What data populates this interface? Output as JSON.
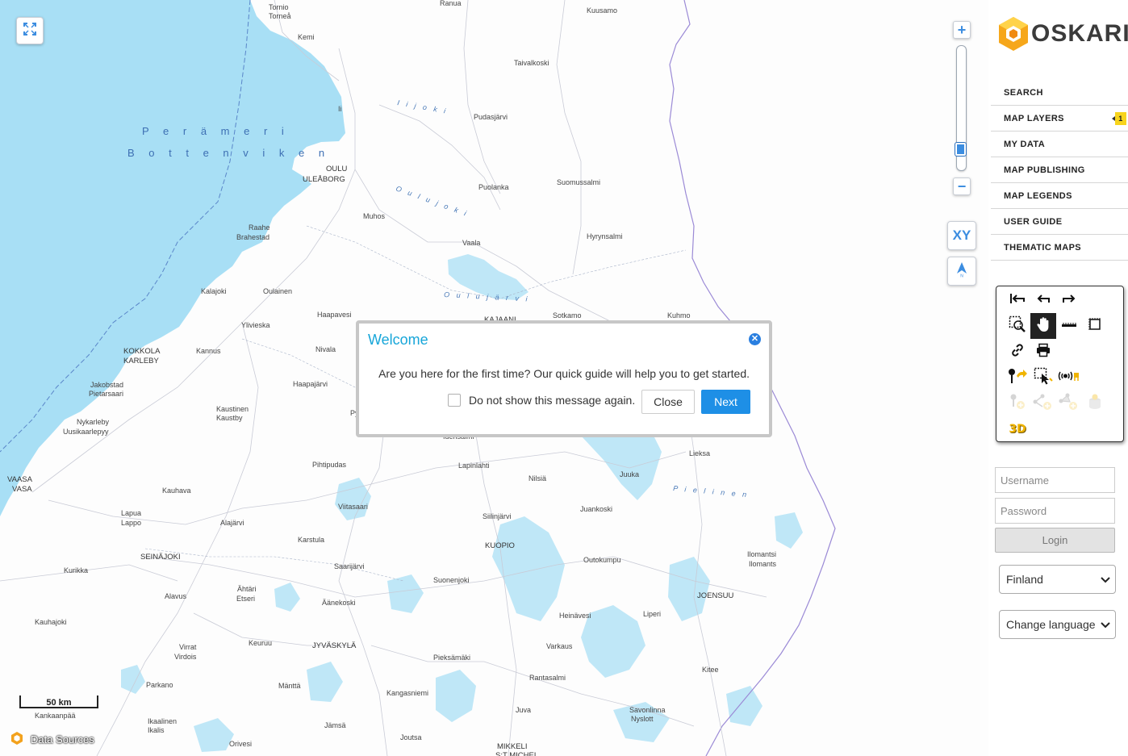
{
  "map": {
    "sea_labels": [
      "P e r ä m e r i",
      "B o t t e n v i k e n"
    ],
    "water_labels": [
      "I i j o k i",
      "O u l u j o k i",
      "O u l u j ä r v i",
      "P i e l i n e n"
    ],
    "places": [
      {
        "name": "Tornio",
        "cap": false
      },
      {
        "name": "Torneå",
        "cap": false
      },
      {
        "name": "Kemi",
        "cap": false
      },
      {
        "name": "Ranua",
        "cap": false
      },
      {
        "name": "Kuusamo",
        "cap": false
      },
      {
        "name": "Taivalkoski",
        "cap": false
      },
      {
        "name": "Ii",
        "cap": false
      },
      {
        "name": "Pudasjärvi",
        "cap": false
      },
      {
        "name": "OULU",
        "cap": true
      },
      {
        "name": "ULEÅBORG",
        "cap": true
      },
      {
        "name": "Muhos",
        "cap": false
      },
      {
        "name": "Puolanka",
        "cap": false
      },
      {
        "name": "Suomussalmi",
        "cap": false
      },
      {
        "name": "Raahe",
        "cap": false
      },
      {
        "name": "Brahestad",
        "cap": false
      },
      {
        "name": "Vaala",
        "cap": false
      },
      {
        "name": "Hyrynsalmi",
        "cap": false
      },
      {
        "name": "Kalajoki",
        "cap": false
      },
      {
        "name": "Oulainen",
        "cap": false
      },
      {
        "name": "Haapavesi",
        "cap": false
      },
      {
        "name": "Sotkamo",
        "cap": false
      },
      {
        "name": "KAJAANI",
        "cap": true
      },
      {
        "name": "Kuhmo",
        "cap": false
      },
      {
        "name": "Ylivieska",
        "cap": false
      },
      {
        "name": "KOKKOLA",
        "cap": true
      },
      {
        "name": "KARLEBY",
        "cap": true
      },
      {
        "name": "Kannus",
        "cap": false
      },
      {
        "name": "Nivala",
        "cap": false
      },
      {
        "name": "Haapajärvi",
        "cap": false
      },
      {
        "name": "Jakobstad",
        "cap": false
      },
      {
        "name": "Pietarsaari",
        "cap": false
      },
      {
        "name": "Kaustinen",
        "cap": false
      },
      {
        "name": "Kaustby",
        "cap": false
      },
      {
        "name": "Py",
        "cap": false
      },
      {
        "name": "Idensalmi",
        "cap": false
      },
      {
        "name": "Lieksa",
        "cap": false
      },
      {
        "name": "Nykarleby",
        "cap": false
      },
      {
        "name": "Uusikaarlepyy",
        "cap": false
      },
      {
        "name": "Pihtipudas",
        "cap": false
      },
      {
        "name": "Lapinlahti",
        "cap": false
      },
      {
        "name": "Nilsiä",
        "cap": false
      },
      {
        "name": "Juuka",
        "cap": false
      },
      {
        "name": "VAASA",
        "cap": true
      },
      {
        "name": "VASA",
        "cap": true
      },
      {
        "name": "Kauhava",
        "cap": false
      },
      {
        "name": "Viitasaari",
        "cap": false
      },
      {
        "name": "Juankoski",
        "cap": false
      },
      {
        "name": "Siilinjärvi",
        "cap": false
      },
      {
        "name": "Lapua",
        "cap": false
      },
      {
        "name": "Lappo",
        "cap": false
      },
      {
        "name": "Alajärvi",
        "cap": false
      },
      {
        "name": "Karstula",
        "cap": false
      },
      {
        "name": "KUOPIO",
        "cap": true
      },
      {
        "name": "SEINÄJOKI",
        "cap": true
      },
      {
        "name": "Saarijärvi",
        "cap": false
      },
      {
        "name": "Outokumpu",
        "cap": false
      },
      {
        "name": "Ilomantsi",
        "cap": false
      },
      {
        "name": "Ilomants",
        "cap": false
      },
      {
        "name": "Kurikka",
        "cap": false
      },
      {
        "name": "Suonenjoki",
        "cap": false
      },
      {
        "name": "Ähtäri",
        "cap": false
      },
      {
        "name": "Etseri",
        "cap": false
      },
      {
        "name": "Alavus",
        "cap": false
      },
      {
        "name": "Äänekoski",
        "cap": false
      },
      {
        "name": "JOENSUU",
        "cap": true
      },
      {
        "name": "Kauhajoki",
        "cap": false
      },
      {
        "name": "Heinävesi",
        "cap": false
      },
      {
        "name": "Liperi",
        "cap": false
      },
      {
        "name": "Keuruu",
        "cap": false
      },
      {
        "name": "JYVÄSKYLÄ",
        "cap": true
      },
      {
        "name": "Virrat",
        "cap": false
      },
      {
        "name": "Virdois",
        "cap": false
      },
      {
        "name": "Varkaus",
        "cap": false
      },
      {
        "name": "Pieksämäki",
        "cap": false
      },
      {
        "name": "Kitee",
        "cap": false
      },
      {
        "name": "Parkano",
        "cap": false
      },
      {
        "name": "Mänttä",
        "cap": false
      },
      {
        "name": "Rantasalmi",
        "cap": false
      },
      {
        "name": "Kangasniemi",
        "cap": false
      },
      {
        "name": "Juva",
        "cap": false
      },
      {
        "name": "Savonlinna",
        "cap": false
      },
      {
        "name": "Nyslott",
        "cap": false
      },
      {
        "name": "Kankaanpää",
        "cap": false
      },
      {
        "name": "Ikaalinen",
        "cap": false
      },
      {
        "name": "Ikalis",
        "cap": false
      },
      {
        "name": "Jämsä",
        "cap": false
      },
      {
        "name": "Joutsa",
        "cap": false
      },
      {
        "name": "Orivesi",
        "cap": false
      },
      {
        "name": "MIKKELI",
        "cap": true
      },
      {
        "name": "S:T MICHEL",
        "cap": true
      }
    ],
    "scale_label": "50 km",
    "data_sources_label": "Data Sources",
    "xy_label": "XY"
  },
  "welcome": {
    "title": "Welcome",
    "text": "Are you here for the first time? Our quick guide will help you to get started.",
    "dont_show": "Do not show this message again.",
    "close_label": "Close",
    "next_label": "Next"
  },
  "sidebar": {
    "logo_text": "OSKARI",
    "menu": [
      {
        "label": "SEARCH"
      },
      {
        "label": "MAP LAYERS",
        "badge": "1"
      },
      {
        "label": "MY DATA"
      },
      {
        "label": "MAP PUBLISHING"
      },
      {
        "label": "MAP LEGENDS"
      },
      {
        "label": "USER GUIDE"
      },
      {
        "label": "THEMATIC MAPS"
      }
    ],
    "login": {
      "username_placeholder": "Username",
      "password_placeholder": "Password",
      "login_label": "Login"
    },
    "country_select": "Finland",
    "language_select": "Change language",
    "toolbar_3d_label": "3D"
  },
  "colors": {
    "sea": "#a8dff5",
    "accent": "#1e8fe6",
    "badge": "#f8d41c",
    "title": "#17a6d9"
  }
}
